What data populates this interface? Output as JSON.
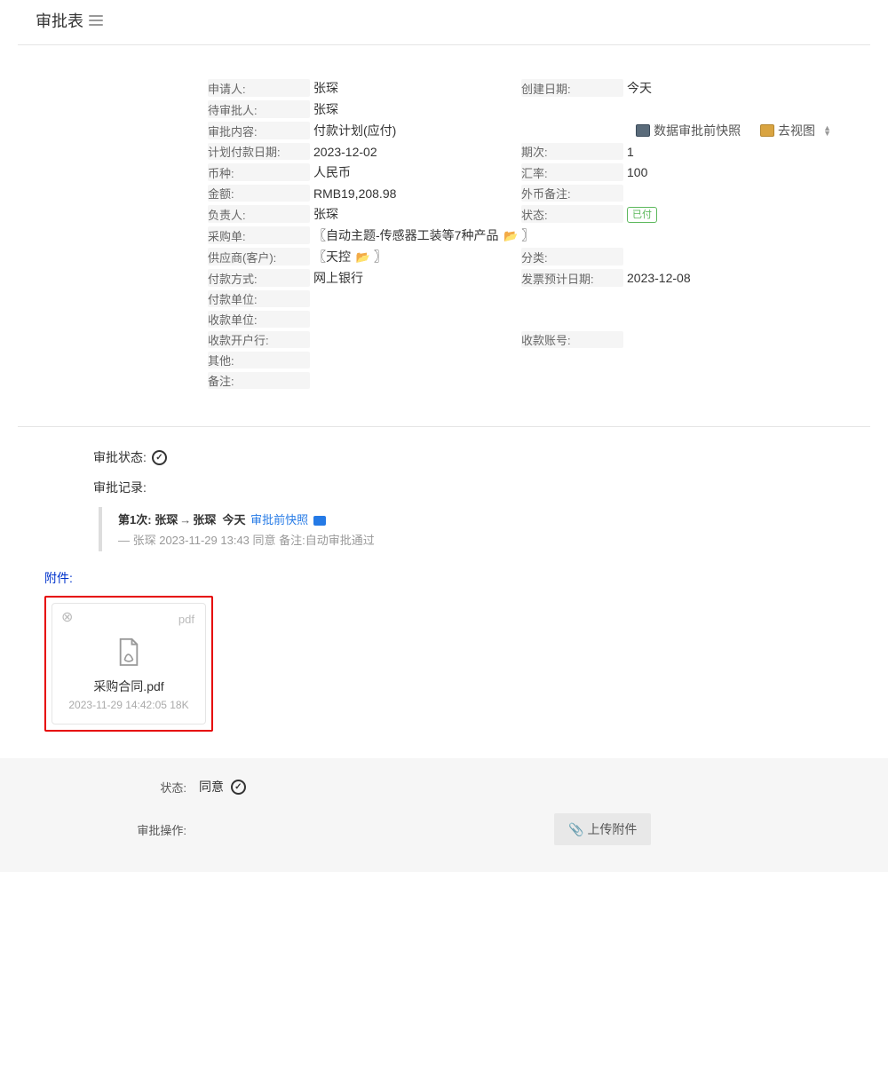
{
  "page_title": "审批表",
  "form": {
    "applicant_label": "申请人:",
    "applicant": "张琛",
    "create_date_label": "创建日期:",
    "create_date": "今天",
    "pending_approver_label": "待审批人:",
    "pending_approver": "张琛",
    "content_label": "审批内容:",
    "content": "付款计划(应付)",
    "action_snapshot": "数据审批前快照",
    "action_goto_view": "去视图",
    "pay_date_label": "计划付款日期:",
    "pay_date": "2023-12-02",
    "period_label": "期次:",
    "period": "1",
    "currency_label": "币种:",
    "currency": "人民币",
    "rate_label": "汇率:",
    "rate": "100",
    "amount_label": "金额:",
    "amount": "RMB19,208.98",
    "fc_remark_label": "外币备注:",
    "fc_remark": "",
    "owner_label": "负责人:",
    "owner": "张琛",
    "status_label": "状态:",
    "status_badge": "已付",
    "po_label": "采购单:",
    "po": "〖自动主题-传感器工装等7种产品",
    "po_suffix": "〗",
    "supplier_label": "供应商(客户):",
    "supplier": "〖天控",
    "supplier_suffix": "〗",
    "category_label": "分类:",
    "category": "",
    "paymethod_label": "付款方式:",
    "paymethod": "网上银行",
    "invoice_date_label": "发票预计日期:",
    "invoice_date": "2023-12-08",
    "pay_unit_label": "付款单位:",
    "pay_unit": "",
    "recv_unit_label": "收款单位:",
    "recv_unit": "",
    "recv_bank_label": "收款开户行:",
    "recv_bank": "",
    "recv_acct_label": "收款账号:",
    "recv_acct": "",
    "other_label": "其他:",
    "other": "",
    "remark_label": "备注:",
    "remark": ""
  },
  "approve": {
    "status_label": "审批状态:",
    "record_label": "审批记录:",
    "rec_title_prefix": "第1次:",
    "rec_from": "张琛",
    "rec_to": "张琛",
    "rec_when": "今天",
    "rec_snap": "审批前快照",
    "rec_sub": "— 张琛 2023-11-29 13:43 同意 备注:自动审批通过"
  },
  "attach": {
    "section_label": "附件:",
    "ext": "pdf",
    "file_name": "采购合同.pdf",
    "file_meta": "2023-11-29 14:42:05 18K"
  },
  "footer": {
    "status_label": "状态:",
    "status_value": "同意",
    "op_label": "审批操作:",
    "upload_btn": "上传附件"
  }
}
